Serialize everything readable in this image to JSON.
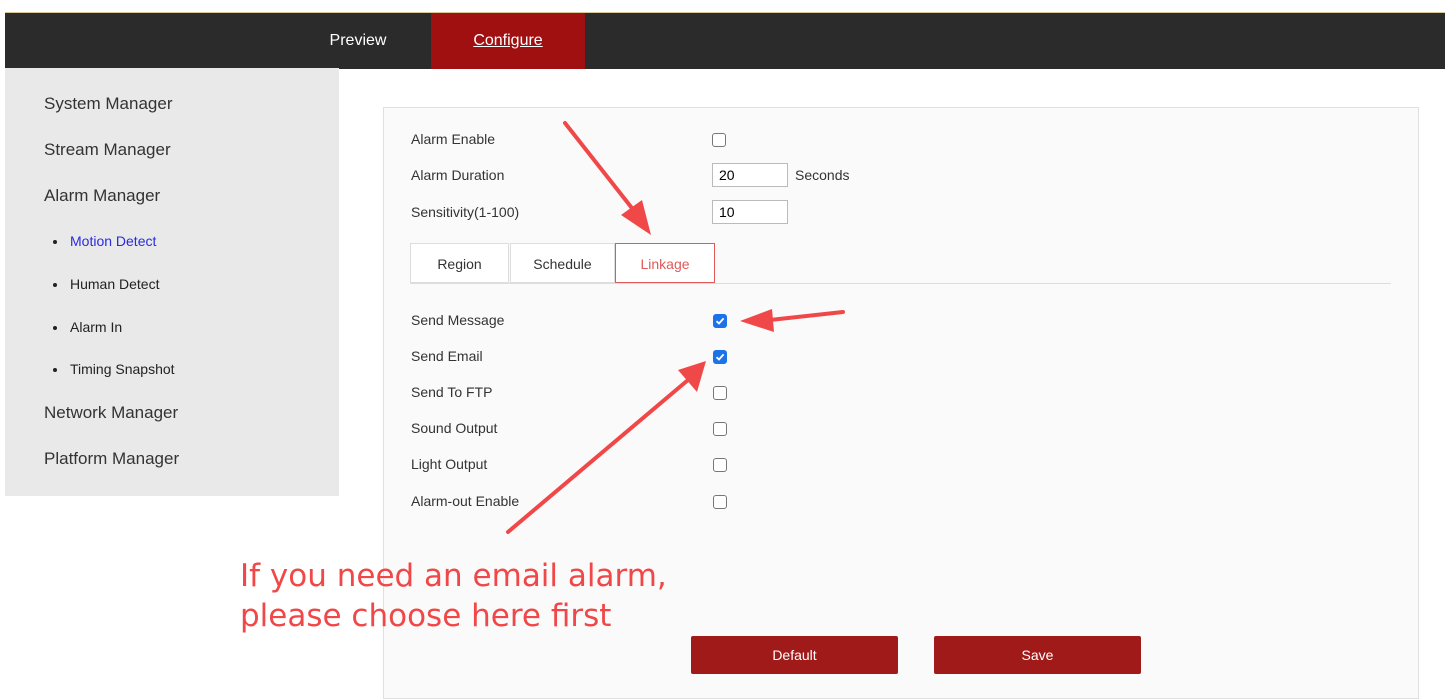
{
  "nav": {
    "preview": "Preview",
    "configure": "Configure"
  },
  "sidebar": {
    "items": [
      {
        "label": "System Manager"
      },
      {
        "label": "Stream Manager"
      },
      {
        "label": "Alarm Manager"
      },
      {
        "label": "Network Manager"
      },
      {
        "label": "Platform Manager"
      }
    ],
    "sub_items": [
      {
        "label": "Motion Detect",
        "active": true
      },
      {
        "label": "Human Detect"
      },
      {
        "label": "Alarm In"
      },
      {
        "label": "Timing Snapshot"
      }
    ]
  },
  "form": {
    "alarm_enable": {
      "label": "Alarm Enable",
      "checked": false
    },
    "alarm_duration": {
      "label": "Alarm Duration",
      "value": "20",
      "unit": "Seconds"
    },
    "sensitivity": {
      "label": "Sensitivity(1-100)",
      "value": "10"
    }
  },
  "tabs": [
    {
      "label": "Region"
    },
    {
      "label": "Schedule"
    },
    {
      "label": "Linkage",
      "active": true
    }
  ],
  "linkage": [
    {
      "label": "Send Message",
      "checked": true
    },
    {
      "label": "Send Email",
      "checked": true
    },
    {
      "label": "Send To FTP",
      "checked": false
    },
    {
      "label": "Sound Output",
      "checked": false
    },
    {
      "label": "Light Output",
      "checked": false
    },
    {
      "label": "Alarm-out Enable",
      "checked": false
    }
  ],
  "buttons": {
    "default": "Default",
    "save": "Save"
  },
  "annotation": {
    "line1": "If you need an email alarm,",
    "line2": "please choose here first",
    "color": "#f04848"
  },
  "colors": {
    "topbar": "#2b2b2b",
    "accent": "#a01010",
    "button": "#a11a1a",
    "checkbox": "#1a73e8"
  }
}
